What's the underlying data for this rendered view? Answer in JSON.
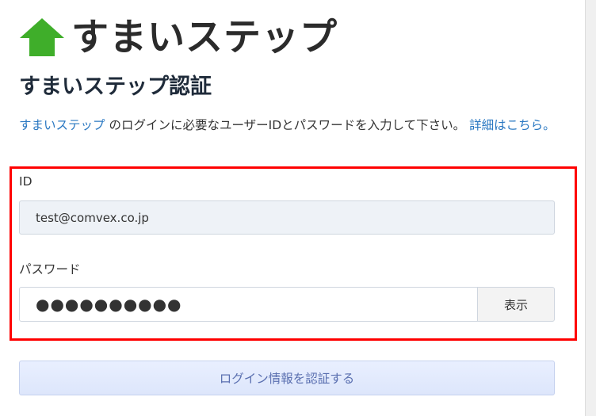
{
  "brand": {
    "name": "すまいステップ",
    "icon": "house-icon",
    "icon_color": "#3fae2a"
  },
  "page_title": "すまいステップ認証",
  "description": {
    "link_text": "すまいステップ",
    "text": " のログインに必要なユーザーIDとパスワードを入力して下さい。 ",
    "details_link": "詳細はこちら。"
  },
  "form": {
    "id_label": "ID",
    "id_value": "test@comvex.co.jp",
    "password_label": "パスワード",
    "password_masked": "●●●●●●●●●●",
    "show_button": "表示",
    "submit_button": "ログイン情報を認証する"
  },
  "colors": {
    "highlight_border": "#ff0000",
    "link": "#2a78c2"
  }
}
